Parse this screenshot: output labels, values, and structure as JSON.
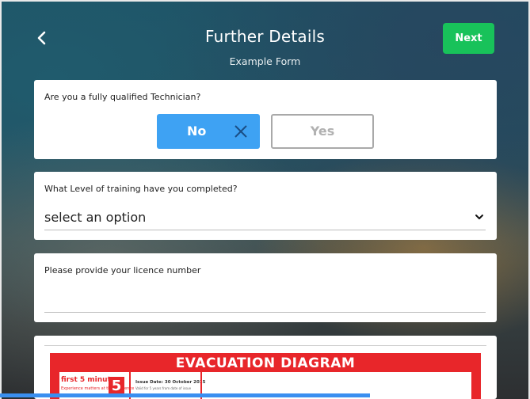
{
  "header": {
    "title": "Further Details",
    "subtitle": "Example Form",
    "next_label": "Next",
    "back_icon": "chevron-left-icon"
  },
  "colors": {
    "next_button": "#18c25a",
    "selected_option": "#3ea2f3",
    "unselected_option_border": "#a9a9a9",
    "scroll_indicator": "#3a8ff0",
    "evacuation_red": "#e8262a"
  },
  "questions": {
    "qualified": {
      "label": "Are you a fully qualified Technician?",
      "options": [
        {
          "label": "No",
          "selected": true,
          "icon": "close-icon"
        },
        {
          "label": "Yes",
          "selected": false
        }
      ]
    },
    "training": {
      "label": "What Level of training have you completed?",
      "selected_value": "select an option",
      "icon": "chevron-down-icon"
    },
    "licence": {
      "label": "Please provide your licence number",
      "value": ""
    }
  },
  "image_card": {
    "title": "EVACUATION  DIAGRAM",
    "first_label": "first 5 minutes",
    "first_sub": "Experience matters at the difference",
    "number": "5",
    "issue_date": "Issue Date: 30 October 2015",
    "issue_sub": "Valid for 5 years from date of issue"
  }
}
